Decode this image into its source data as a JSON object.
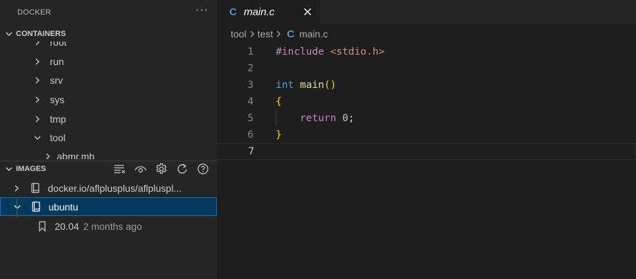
{
  "sidebar": {
    "title": "DOCKER",
    "more_label": "···",
    "containers": {
      "header": "CONTAINERS",
      "items": [
        {
          "label": "root"
        },
        {
          "label": "run"
        },
        {
          "label": "srv"
        },
        {
          "label": "sys"
        },
        {
          "label": "tmp"
        },
        {
          "label": "tool",
          "expanded": true
        },
        {
          "label": "abmr.mb"
        }
      ]
    },
    "images": {
      "header": "IMAGES",
      "actions": [
        "group-by-icon",
        "eye-icon",
        "gear-icon",
        "refresh-icon",
        "help-icon"
      ],
      "items": [
        {
          "label": "docker.io/aflplusplus/aflpluspl...",
          "expanded": false
        },
        {
          "label": "ubuntu",
          "expanded": true,
          "selected": true
        }
      ],
      "tag": {
        "label": "20.04",
        "description": "2 months ago"
      }
    }
  },
  "editor": {
    "tab": {
      "icon": "C",
      "label": "main.c"
    },
    "breadcrumb": [
      "tool",
      "test",
      "main.c"
    ],
    "breadcrumb_icon": "C",
    "lines": [
      {
        "num": "1",
        "tokens": [
          [
            "k-pre",
            "#include "
          ],
          [
            "k-inc",
            "<stdio.h>"
          ]
        ]
      },
      {
        "num": "2",
        "tokens": []
      },
      {
        "num": "3",
        "tokens": [
          [
            "k-type",
            "int "
          ],
          [
            "k-fn",
            "main"
          ],
          [
            "k-paren",
            "()"
          ]
        ]
      },
      {
        "num": "4",
        "tokens": [
          [
            "k-paren",
            "{"
          ]
        ]
      },
      {
        "num": "5",
        "tokens": [
          [
            "k-plain",
            "    "
          ],
          [
            "k-ret",
            "return "
          ],
          [
            "k-num",
            "0"
          ],
          [
            "k-plain",
            ";"
          ]
        ]
      },
      {
        "num": "6",
        "tokens": [
          [
            "k-paren",
            "}"
          ]
        ]
      },
      {
        "num": "7",
        "tokens": []
      }
    ],
    "active_line": "7"
  },
  "colors": {
    "sidebar_bg": "#252526",
    "editor_bg": "#1e1e1e",
    "selection_bg": "#04395e",
    "selection_border": "#0e70c0",
    "c_icon": "#519aba"
  }
}
